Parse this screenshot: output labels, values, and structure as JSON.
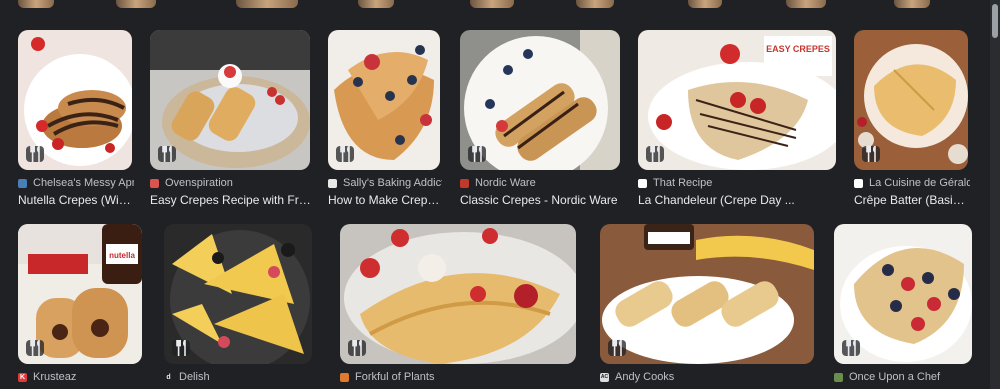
{
  "results": [
    {
      "source": "Chelsea's Messy Apron",
      "title": "Nutella Crepes (With...",
      "favicon_color": "#4a7fb5",
      "favicon_letter": ""
    },
    {
      "source": "Ovenspiration",
      "title": "Easy Crepes Recipe with Frui...",
      "favicon_color": "#d9534f",
      "favicon_letter": ""
    },
    {
      "source": "Sally's Baking Addicti...",
      "title": "How to Make Crepes...",
      "favicon_color": "#e8e8e8",
      "favicon_letter": ""
    },
    {
      "source": "Nordic Ware",
      "title": "Classic Crepes - Nordic Ware",
      "favicon_color": "#c0392b",
      "favicon_letter": ""
    },
    {
      "source": "That Recipe",
      "title": "La Chandeleur (Crepe Day ...",
      "favicon_color": "#ffffff",
      "favicon_letter": ""
    },
    {
      "source": "La Cuisine de Géraldi...",
      "title": "Crêpe Batter (Basic ...",
      "favicon_color": "#ffffff",
      "favicon_letter": ""
    },
    {
      "source": "Krusteaz",
      "title": "",
      "favicon_color": "#e03b3b",
      "favicon_letter": "K"
    },
    {
      "source": "Delish",
      "title": "",
      "favicon_color": "#202124",
      "favicon_letter": "d"
    },
    {
      "source": "Forkful of Plants",
      "title": "",
      "favicon_color": "#e07a2e",
      "favicon_letter": ""
    },
    {
      "source": "Andy Cooks",
      "title": "",
      "favicon_color": "#dddddd",
      "favicon_letter": "AC"
    },
    {
      "source": "Once Upon a Chef",
      "title": "",
      "favicon_color": "#6b8e4e",
      "favicon_letter": ""
    }
  ],
  "icons": {
    "recipe_badge": "fork-knife-icon"
  }
}
